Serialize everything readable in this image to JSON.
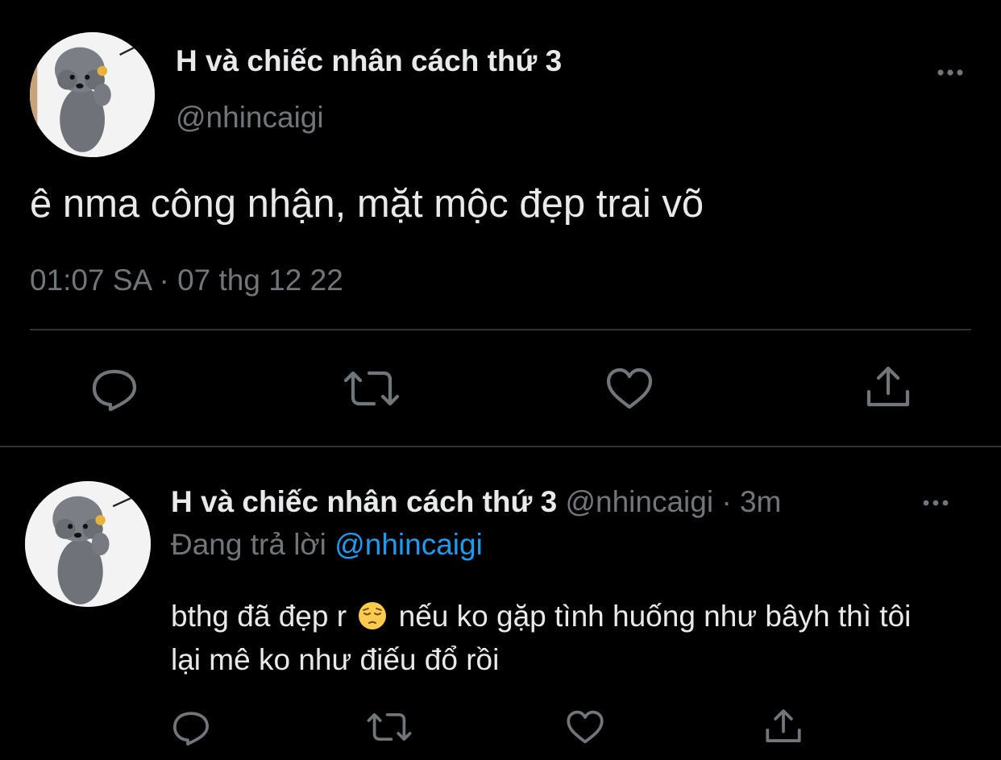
{
  "main_tweet": {
    "display_name": "H và chiếc nhân cách thứ 3",
    "handle": "@nhincaigi",
    "text": "ê nma công nhận, mặt mộc đẹp trai võ",
    "time": "01:07 SA",
    "separator": "·",
    "date": "07 thg 12 22",
    "more_icon": "more-horizontal-icon",
    "actions": [
      "reply-icon",
      "retweet-icon",
      "like-icon",
      "share-icon"
    ]
  },
  "reply_tweet": {
    "display_name": "H và chiếc nhân cách thứ 3",
    "handle": "@nhincaigi",
    "separator": "·",
    "time_ago": "3m",
    "replying_prefix": "Đang trả lời",
    "replying_to": "@nhincaigi",
    "text_before_emoji": "bthg đã đẹp r",
    "emoji": "pensive-face",
    "text_after_emoji": "nếu ko gặp tình huống như bâyh thì tôi lại mê ko như điếu đổ rồi",
    "more_icon": "more-horizontal-icon",
    "actions": [
      "reply-icon",
      "retweet-icon",
      "like-icon",
      "share-icon"
    ]
  },
  "colors": {
    "background": "#000000",
    "primary_text": "#e7e9ea",
    "secondary_text": "#71767b",
    "link": "#1d9bf0",
    "divider": "#2f3336"
  }
}
